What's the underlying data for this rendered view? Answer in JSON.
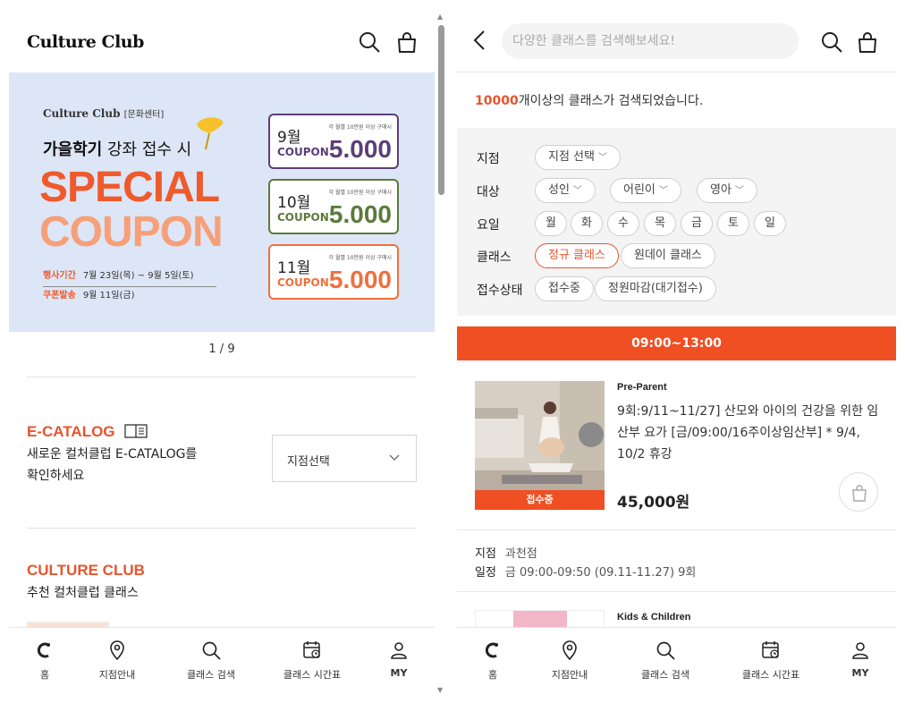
{
  "left": {
    "logo": "Culture Club",
    "banner": {
      "brand": "Culture Club",
      "brand_sub": "[문화센터]",
      "line1_bold": "가을학기",
      "line1_rest": " 강좌 접수 시",
      "special": "SPECIAL",
      "coupon": "COUPON",
      "period_label": "행사기간",
      "period_value": "7월 23일(목) ~ 9월 5일(토)",
      "issue_label": "쿠폰발송",
      "issue_value": "9월 11일(금)",
      "coupons": [
        {
          "month": "9월",
          "word": "COUPON",
          "condition": "각 월별 10만원 이상 구매시",
          "value": "5.000",
          "color": "#5b3f77"
        },
        {
          "month": "10월",
          "word": "COUPON",
          "condition": "각 월별 10만원 이상 구매시",
          "value": "5.000",
          "color": "#5c7a3a"
        },
        {
          "month": "11월",
          "word": "COUPON",
          "condition": "각 월별 10만원 이상 구매시",
          "value": "5.000",
          "color": "#f0703c"
        }
      ]
    },
    "pager": "1 / 9",
    "ecatalog": {
      "title": "E-CATALOG",
      "desc_line1": "새로운 컬처클럽 E-CATALOG를",
      "desc_line2": "확인하세요",
      "select_label": "지점선택"
    },
    "culture": {
      "title": "CULTURE CLUB",
      "subtitle": "추천 컬처클럽 클래스"
    }
  },
  "right": {
    "search_placeholder": "다양한 클래스를 검색해보세요!",
    "result_highlight": "10000",
    "result_text": "개이상의 클래스가 검색되었습니다.",
    "filters": {
      "branch_label": "지점",
      "branch_chip": "지점 선택",
      "target_label": "대상",
      "target_chips": [
        "성인",
        "어린이",
        "영아"
      ],
      "day_label": "요일",
      "days": [
        "월",
        "화",
        "수",
        "목",
        "금",
        "토",
        "일"
      ],
      "class_label": "클래스",
      "class_chips": [
        "정규 클래스",
        "원데이 클래스"
      ],
      "status_label": "접수상태",
      "status_chips": [
        "접수중",
        "정원마감(대기접수)"
      ]
    },
    "time_slot": "09:00~13:00",
    "course": {
      "category": "Pre-Parent",
      "title": "9회:9/11~11/27] 산모와 아이의 건강을 위한 임산부 요가 [금/09:00/16주이상임산부] * 9/4, 10/2 휴강",
      "price": "45,000원",
      "badge": "접수중",
      "branch_label": "지점",
      "branch_value": "과천점",
      "schedule_label": "일정",
      "schedule_value": "금 09:00-09:50 (09.11-11.27) 9회"
    },
    "next_category": "Kids & Children"
  },
  "nav": {
    "items": [
      "홈",
      "지점안내",
      "클래스 검색",
      "클래스 시간표",
      "MY"
    ]
  },
  "colors": {
    "accent": "#f04f23",
    "accent_text": "#e8542e"
  }
}
